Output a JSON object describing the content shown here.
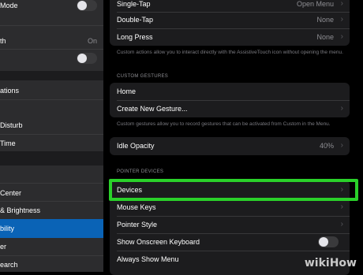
{
  "left_pane": {
    "rows": [
      {
        "label": "Mode",
        "toggle": "off"
      },
      {
        "label": "th",
        "value": "On"
      },
      {
        "label": "",
        "toggle": "off"
      },
      {
        "label": "ations"
      },
      {
        "label": "Disturb"
      },
      {
        "label": "Time"
      },
      {
        "label": "Center"
      },
      {
        "label": "& Brightness"
      },
      {
        "label": "bility",
        "selected": true
      },
      {
        "label": "er"
      },
      {
        "label": "earch"
      }
    ]
  },
  "right_pane": {
    "top_rows": [
      {
        "label": "Single-Tap",
        "value": "Open Menu"
      },
      {
        "label": "Double-Tap",
        "value": "None"
      },
      {
        "label": "Long Press",
        "value": "None"
      }
    ],
    "custom_actions_note": "Custom actions allow you to interact directly with the AssistiveTouch icon without opening the menu.",
    "custom_gestures_header": "CUSTOM GESTURES",
    "gesture_rows": [
      {
        "label": "Home"
      },
      {
        "label": "Create New Gesture..."
      }
    ],
    "custom_gestures_note": "Custom gestures allow you to record gestures that can be activated from Custom in the Menu.",
    "idle_opacity": {
      "label": "Idle Opacity",
      "value": "40%"
    },
    "pointer_devices_header": "POINTER DEVICES",
    "pointer_rows": [
      {
        "label": "Devices"
      },
      {
        "label": "Mouse Keys"
      },
      {
        "label": "Pointer Style"
      },
      {
        "label": "Show Onscreen Keyboard",
        "toggle": "off"
      },
      {
        "label": "Always Show Menu"
      }
    ]
  },
  "watermark": "wikiHow",
  "colors": {
    "highlight": "#2ad12a",
    "selected": "#0a63b6"
  }
}
